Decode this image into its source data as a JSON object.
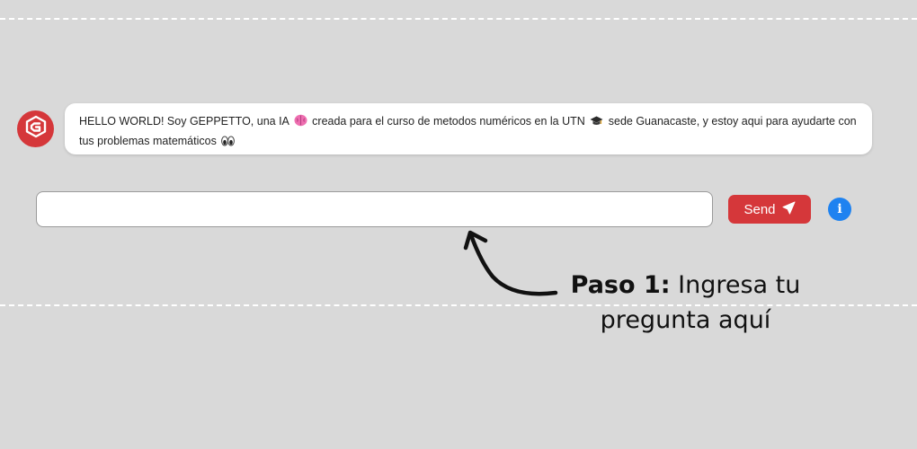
{
  "chat": {
    "bot_message_part1": "HELLO WORLD! Soy GEPPETTO, una IA",
    "bot_message_part2": "creada para el curso de metodos numéricos en la UTN",
    "bot_message_part3": "sede Guanacaste, y estoy aqui para ayudarte con tus problemas matemáticos",
    "bot_avatar_icon": "geppetto-logo-icon",
    "message_icons": [
      "brain-icon",
      "graduation-cap-icon",
      "eyes-icon"
    ]
  },
  "input": {
    "value": "",
    "placeholder": ""
  },
  "send_button": {
    "label": "Send",
    "icon": "paper-plane-icon"
  },
  "info_button": {
    "label": "i",
    "icon": "info-icon"
  },
  "annotation": {
    "step_label": "Paso 1:",
    "step_text": "Ingresa tu pregunta aquí"
  },
  "colors": {
    "background": "#d9d9d9",
    "accent_red": "#d5373a",
    "info_blue": "#1e82f0"
  }
}
